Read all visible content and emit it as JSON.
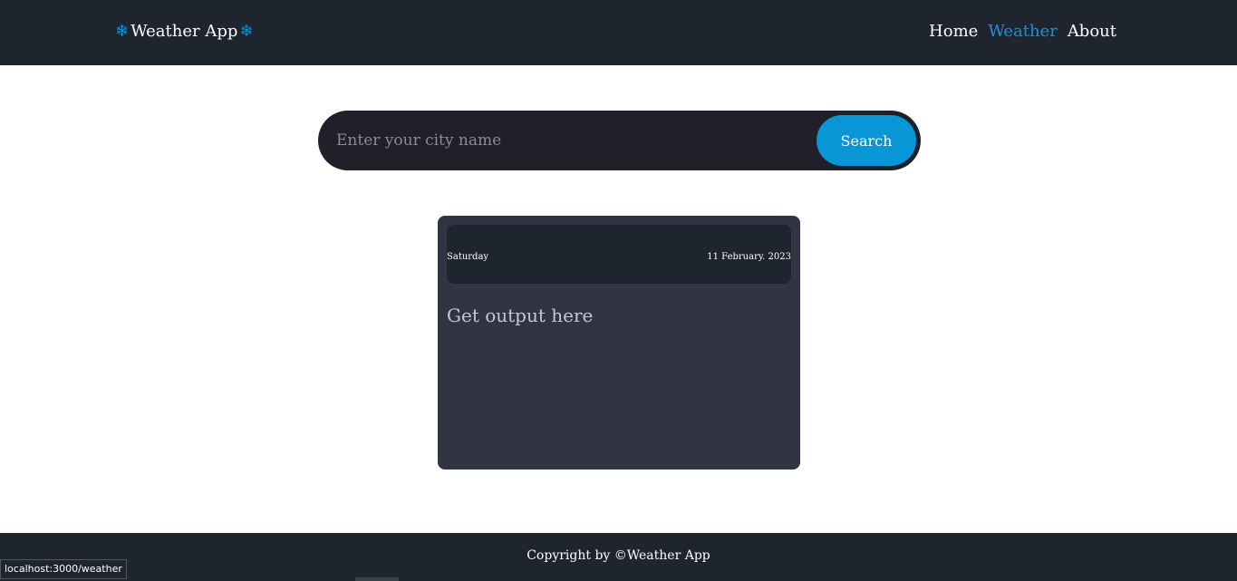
{
  "header": {
    "brand": {
      "title": "Weather App",
      "icon_left": "snowflake-icon",
      "icon_right": "snowflake-icon"
    },
    "nav": [
      {
        "label": "Home",
        "active": false
      },
      {
        "label": "Weather",
        "active": true
      },
      {
        "label": "About",
        "active": false
      }
    ]
  },
  "search": {
    "placeholder": "Enter your city name",
    "value": "",
    "button_label": "Search"
  },
  "card": {
    "day": "Saturday",
    "date": "11 February. 2023",
    "output": "Get output here"
  },
  "footer": {
    "text": "Copyright by ©Weather App"
  },
  "status_bar": {
    "url": "localhost:3000/weather"
  },
  "colors": {
    "navbar": "#1f252e",
    "accent": "#0896d6",
    "card": "#313443",
    "search_bar": "#1f2029"
  }
}
